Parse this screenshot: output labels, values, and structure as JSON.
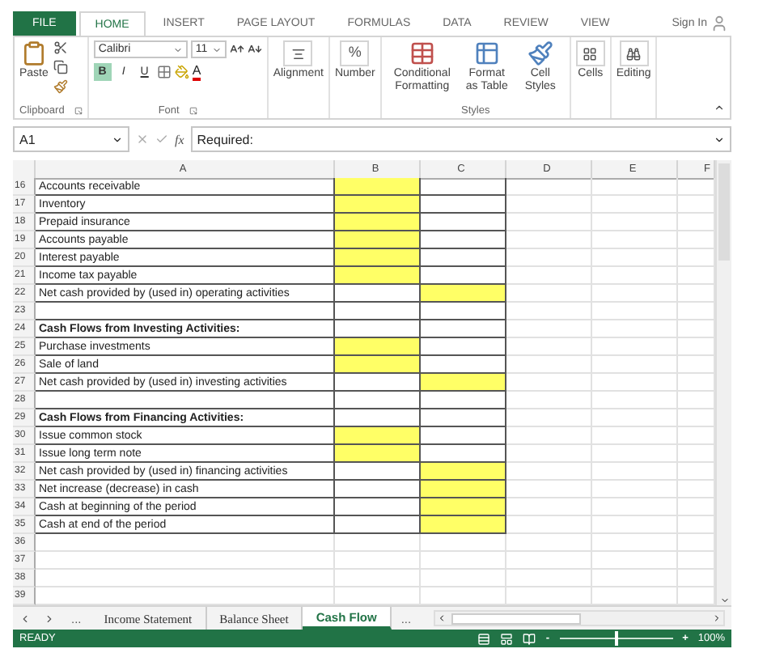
{
  "ribbon_tabs": [
    {
      "label": "FILE",
      "kind": "file",
      "selected": false
    },
    {
      "label": "HOME",
      "kind": "tab",
      "selected": true
    },
    {
      "label": "INSERT",
      "kind": "tab",
      "selected": false
    },
    {
      "label": "PAGE LAYOUT",
      "kind": "tab",
      "selected": false
    },
    {
      "label": "FORMULAS",
      "kind": "tab",
      "selected": false
    },
    {
      "label": "DATA",
      "kind": "tab",
      "selected": false
    },
    {
      "label": "REVIEW",
      "kind": "tab",
      "selected": false
    },
    {
      "label": "VIEW",
      "kind": "tab",
      "selected": false
    }
  ],
  "account": {
    "label": "Sign In"
  },
  "ribbon": {
    "clipboard": {
      "paste": "Paste",
      "group": "Clipboard"
    },
    "font": {
      "name": "Calibri",
      "size": "11",
      "bold": "B",
      "italic": "I",
      "underline": "U",
      "font_color_glyph": "A",
      "group": "Font"
    },
    "alignment": "Alignment",
    "number": {
      "symbol": "%",
      "label": "Number"
    },
    "styles": {
      "items": [
        "Conditional Formatting",
        "Format as Table",
        "Cell Styles"
      ],
      "group": "Styles"
    },
    "cells": "Cells",
    "editing": "Editing"
  },
  "formula_bar": {
    "name_box": "A1",
    "function_label": "fx",
    "content": "Required:"
  },
  "columns": [
    "A",
    "B",
    "C",
    "D",
    "E",
    "F"
  ],
  "rows": [
    {
      "number": "16",
      "label": "Accounts receivable",
      "bold": false,
      "bordered": true,
      "b_highlighted": true,
      "c_highlighted": false
    },
    {
      "number": "17",
      "label": "Inventory",
      "bold": false,
      "bordered": true,
      "b_highlighted": true,
      "c_highlighted": false
    },
    {
      "number": "18",
      "label": "Prepaid insurance",
      "bold": false,
      "bordered": true,
      "b_highlighted": true,
      "c_highlighted": false
    },
    {
      "number": "19",
      "label": "Accounts payable",
      "bold": false,
      "bordered": true,
      "b_highlighted": true,
      "c_highlighted": false
    },
    {
      "number": "20",
      "label": "Interest payable",
      "bold": false,
      "bordered": true,
      "b_highlighted": true,
      "c_highlighted": false
    },
    {
      "number": "21",
      "label": "Income tax payable",
      "bold": false,
      "bordered": true,
      "b_highlighted": true,
      "c_highlighted": false
    },
    {
      "number": "22",
      "label": "Net cash provided by (used in) operating activities",
      "bold": false,
      "bordered": true,
      "b_highlighted": false,
      "c_highlighted": true
    },
    {
      "number": "23",
      "bordered": true,
      "b_highlighted": false,
      "c_highlighted": false
    },
    {
      "number": "24",
      "label": "Cash Flows from Investing Activities:",
      "bold": true,
      "bordered": true,
      "b_highlighted": false,
      "c_highlighted": false
    },
    {
      "number": "25",
      "label": "Purchase investments",
      "bold": false,
      "bordered": true,
      "b_highlighted": true,
      "c_highlighted": false
    },
    {
      "number": "26",
      "label": "Sale of land",
      "bold": false,
      "bordered": true,
      "b_highlighted": true,
      "c_highlighted": false
    },
    {
      "number": "27",
      "label": "Net cash provided by (used in) investing activities",
      "bold": false,
      "bordered": true,
      "b_highlighted": false,
      "c_highlighted": true
    },
    {
      "number": "28",
      "bordered": true,
      "b_highlighted": false,
      "c_highlighted": false
    },
    {
      "number": "29",
      "label": "Cash Flows from Financing Activities:",
      "bold": true,
      "bordered": true,
      "b_highlighted": false,
      "c_highlighted": false
    },
    {
      "number": "30",
      "label": "Issue common stock",
      "bold": false,
      "bordered": true,
      "b_highlighted": true,
      "c_highlighted": false
    },
    {
      "number": "31",
      "label": "Issue long term note",
      "bold": false,
      "bordered": true,
      "b_highlighted": true,
      "c_highlighted": false
    },
    {
      "number": "32",
      "label": "Net cash provided by (used in) financing activities",
      "bold": false,
      "bordered": true,
      "b_highlighted": false,
      "c_highlighted": true
    },
    {
      "number": "33",
      "label": "Net increase (decrease) in cash",
      "bold": false,
      "bordered": true,
      "b_highlighted": false,
      "c_highlighted": true
    },
    {
      "number": "34",
      "label": "Cash at beginning of the period",
      "bold": false,
      "bordered": true,
      "b_highlighted": false,
      "c_highlighted": true
    },
    {
      "number": "35",
      "label": "Cash at end of the period",
      "bold": false,
      "bordered": true,
      "b_highlighted": false,
      "c_highlighted": true
    },
    {
      "number": "36",
      "bordered": false,
      "b_highlighted": false,
      "c_highlighted": false
    },
    {
      "number": "37",
      "bordered": false,
      "b_highlighted": false,
      "c_highlighted": false
    },
    {
      "number": "38",
      "bordered": false,
      "b_highlighted": false,
      "c_highlighted": false
    },
    {
      "number": "39",
      "bordered": false,
      "b_highlighted": false,
      "c_highlighted": false
    }
  ],
  "sheet_nav": {
    "more_left": "...",
    "more_right": "..."
  },
  "sheets": [
    {
      "label": "Income Statement",
      "selected": false
    },
    {
      "label": "Balance Sheet",
      "selected": false
    },
    {
      "label": "Cash Flow",
      "selected": true
    }
  ],
  "status_bar": {
    "status": "READY",
    "zoom": {
      "zoom_out": "-",
      "level": 0.5,
      "zoom_in": "+",
      "reading": "100%"
    }
  }
}
